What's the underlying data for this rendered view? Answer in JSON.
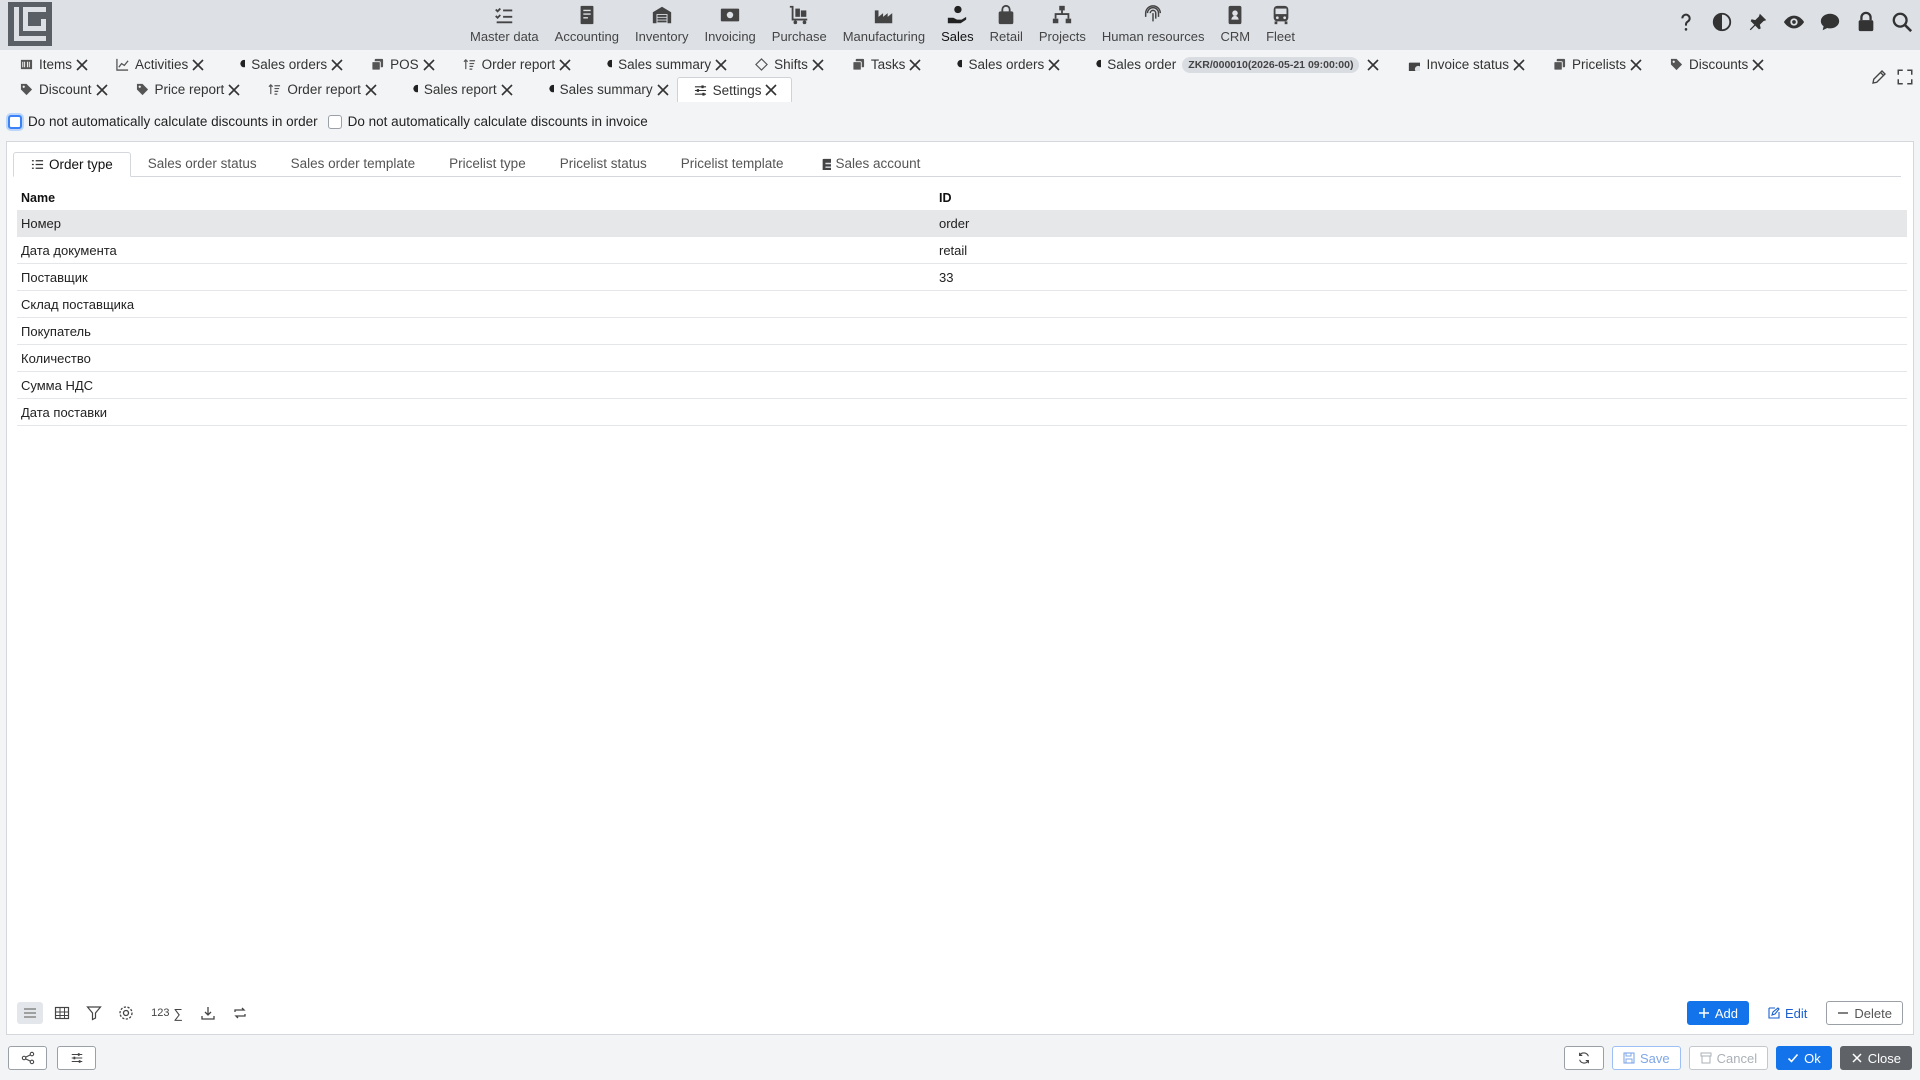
{
  "colors": {
    "accent": "#1273eb",
    "topbar": "#dde1e6",
    "selected_row": "#e6e7e9",
    "close_button": "#5f6368"
  },
  "modules": [
    {
      "label": "Master data",
      "icon": "list-check-icon"
    },
    {
      "label": "Accounting",
      "icon": "ledger-icon"
    },
    {
      "label": "Inventory",
      "icon": "warehouse-icon"
    },
    {
      "label": "Invoicing",
      "icon": "money-icon"
    },
    {
      "label": "Purchase",
      "icon": "cart-flatbed-icon"
    },
    {
      "label": "Manufacturing",
      "icon": "factory-icon"
    },
    {
      "label": "Sales",
      "icon": "hand-money-icon"
    },
    {
      "label": "Retail",
      "icon": "shopping-bag-icon"
    },
    {
      "label": "Projects",
      "icon": "sitemap-icon"
    },
    {
      "label": "Human resources",
      "icon": "fingerprint-icon"
    },
    {
      "label": "CRM",
      "icon": "contact-book-icon"
    },
    {
      "label": "Fleet",
      "icon": "bus-icon"
    }
  ],
  "doc_tabs_row1": [
    {
      "label": "Items",
      "icon": "barcode-icon"
    },
    {
      "label": "Activities",
      "icon": "chart-line-icon"
    },
    {
      "label": "Sales orders",
      "icon": "hand-money-icon"
    },
    {
      "label": "POS",
      "icon": "copy-icon"
    },
    {
      "label": "Order report",
      "icon": "sort-icon"
    },
    {
      "label": "Sales summary",
      "icon": "hand-money-icon"
    },
    {
      "label": "Shifts",
      "icon": "diamond-icon"
    },
    {
      "label": "Tasks",
      "icon": "copy-icon"
    },
    {
      "label": "Sales orders",
      "icon": "hand-money-icon"
    },
    {
      "label": "Sales order",
      "icon": "hand-money-icon",
      "badge": "ZKR/000010(2026-05-21 09:00:00)"
    },
    {
      "label": "Invoice status",
      "icon": "money-icon"
    },
    {
      "label": "Pricelists",
      "icon": "copy-icon"
    },
    {
      "label": "Discounts",
      "icon": "tag-icon"
    }
  ],
  "doc_tabs_row2": [
    {
      "label": "Discount",
      "icon": "tag-icon"
    },
    {
      "label": "Price report",
      "icon": "tag-icon"
    },
    {
      "label": "Order report",
      "icon": "sort-icon"
    },
    {
      "label": "Sales report",
      "icon": "hand-money-icon"
    },
    {
      "label": "Sales summary",
      "icon": "hand-money-icon"
    },
    {
      "label": "Settings",
      "icon": "sliders-icon",
      "active": true
    }
  ],
  "options": {
    "order_discount": "Do not automatically calculate discounts in order",
    "invoice_discount": "Do not automatically calculate discounts in invoice"
  },
  "sub_tabs": [
    {
      "label": "Order type",
      "active": true,
      "icon": "list-icon"
    },
    {
      "label": "Sales order status"
    },
    {
      "label": "Sales order template"
    },
    {
      "label": "Pricelist type"
    },
    {
      "label": "Pricelist status"
    },
    {
      "label": "Pricelist template"
    },
    {
      "label": "Sales account",
      "icon": "ledger-icon"
    }
  ],
  "table": {
    "headers": {
      "name": "Name",
      "id": "ID"
    },
    "rows": [
      {
        "name": "Номер",
        "id": "order"
      },
      {
        "name": "Дата документа",
        "id": "retail"
      },
      {
        "name": "Поставщик",
        "id": "33"
      },
      {
        "name": "Склад поставщика",
        "id": ""
      },
      {
        "name": "Покупатель",
        "id": ""
      },
      {
        "name": "Количество",
        "id": ""
      },
      {
        "name": "Сумма НДС",
        "id": ""
      },
      {
        "name": "Дата поставки",
        "id": ""
      }
    ]
  },
  "toolbar": {
    "numeric_label": "123",
    "sum_label": "∑"
  },
  "actions": {
    "add": "Add",
    "edit": "Edit",
    "delete": "Delete"
  },
  "footer": {
    "save": "Save",
    "cancel": "Cancel",
    "ok": "Ok",
    "close": "Close"
  }
}
